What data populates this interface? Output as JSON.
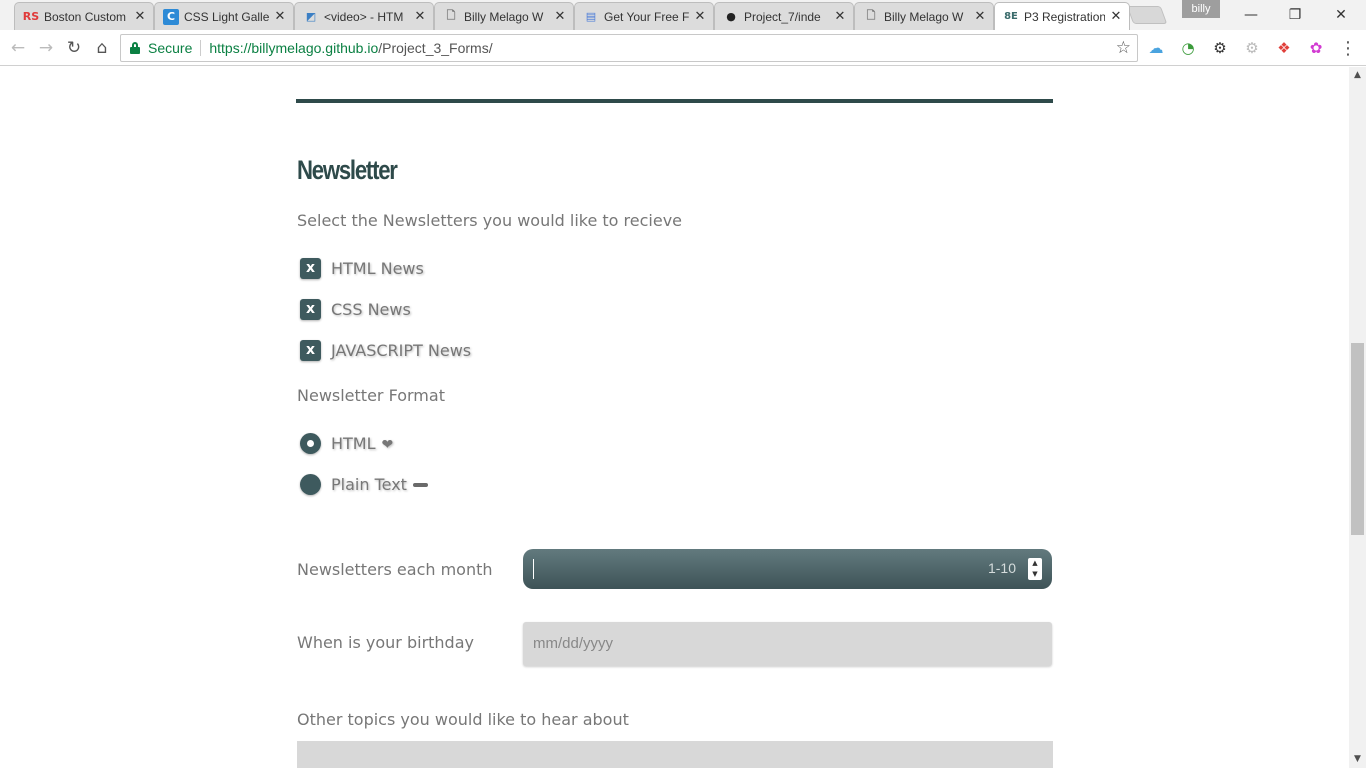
{
  "browser": {
    "tabs": [
      {
        "title": "Boston Custom",
        "favicon_label": "RS",
        "favicon_color": "#e03a3a"
      },
      {
        "title": "CSS Light Galle",
        "favicon_label": "C",
        "favicon_color": "#2d8ad6"
      },
      {
        "title": "<video> - HTM",
        "favicon_label": "◩",
        "favicon_color": "#3b7fc4"
      },
      {
        "title": "Billy Melago W",
        "favicon_label": "🗋",
        "favicon_color": "#777777"
      },
      {
        "title": "Get Your Free F",
        "favicon_label": "▤",
        "favicon_color": "#4a7bd8"
      },
      {
        "title": "Project_7/inde",
        "favicon_label": "●",
        "favicon_color": "#222222"
      },
      {
        "title": "Billy Melago W",
        "favicon_label": "🗋",
        "favicon_color": "#777777"
      },
      {
        "title": "P3 Registration",
        "favicon_label": "8E",
        "favicon_color": "#3a6b6b"
      }
    ],
    "close_glyph": "✕",
    "profile_name": "billy",
    "window_controls": {
      "minimize": "—",
      "restore": "❐",
      "close": "✕"
    },
    "nav": {
      "back": "←",
      "forward": "→",
      "reload": "↻",
      "home": "⌂"
    },
    "security_label": "Secure",
    "url_host": "https://billymelago.github.io",
    "url_path": "/Project_3_Forms/",
    "bookmark_icon": "☆",
    "extensions": [
      {
        "name": "cloud-icon",
        "glyph": "☁",
        "color": "#4aa3df"
      },
      {
        "name": "speed-icon",
        "glyph": "◔",
        "color": "#3b9b3b"
      },
      {
        "name": "gear-icon",
        "glyph": "⚙",
        "color": "#333333"
      },
      {
        "name": "gear-light-icon",
        "glyph": "⚙",
        "color": "#bbbbbb"
      },
      {
        "name": "color-icon",
        "glyph": "❖",
        "color": "#e0403b"
      },
      {
        "name": "palette-icon",
        "glyph": "✿",
        "color": "#d23bd2"
      }
    ],
    "menu_icon": "⋮"
  },
  "page": {
    "section_title": "Newsletter",
    "select_prompt": "Select the Newsletters you would like to recieve",
    "newsletters": [
      {
        "label": "HTML News",
        "mark": "x"
      },
      {
        "label": "CSS News",
        "mark": "x"
      },
      {
        "label": "JAVASCRIPT News",
        "mark": "x"
      }
    ],
    "format_label": "Newsletter Format",
    "formats": [
      {
        "label": "HTML",
        "selected": true,
        "icon": "heart-icon"
      },
      {
        "label": "Plain Text",
        "selected": false,
        "icon": "dash-icon"
      }
    ],
    "heart_glyph": "❤",
    "frequency_label": "Newsletters each month",
    "frequency_placeholder": "1-10",
    "spinner_up": "▲",
    "spinner_down": "▼",
    "birthday_label": "When is your birthday",
    "birthday_placeholder": "mm/dd/yyyy",
    "topics_label": "Other topics you would like to hear about"
  },
  "scrollbar": {
    "up": "▲",
    "down": "▼"
  }
}
